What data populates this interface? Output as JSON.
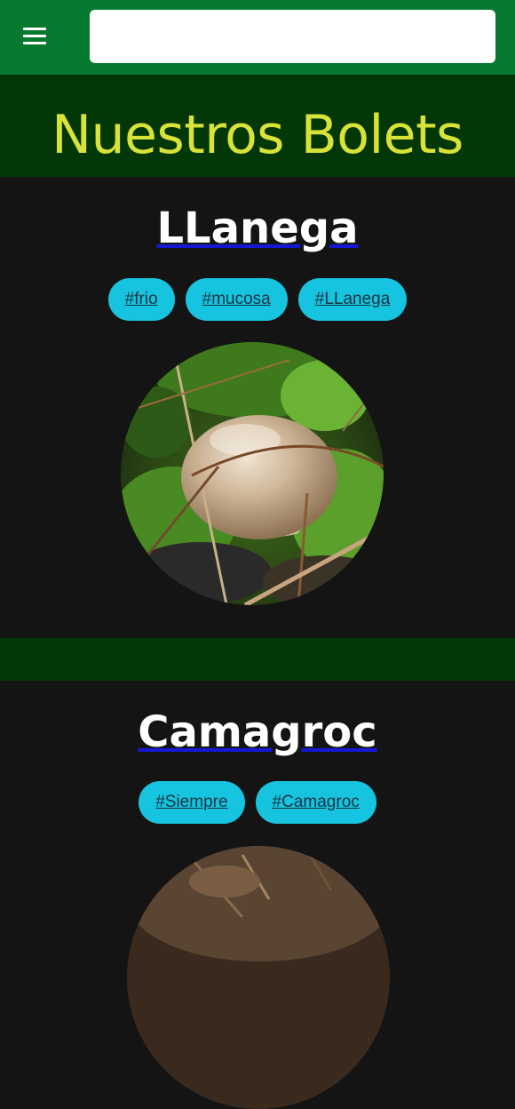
{
  "header": {
    "menu_icon": "hamburger-menu-icon",
    "search": {
      "value": "",
      "placeholder": ""
    },
    "colors": {
      "bar": "#077a32",
      "search_bg": "#ffffff"
    }
  },
  "hero": {
    "title": "Nuestros Bolets",
    "colors": {
      "bg": "#023808",
      "title": "#d9e237"
    }
  },
  "boletes": [
    {
      "name": "LLanega",
      "tags": [
        "#frio",
        "#mucosa",
        "#LLanega"
      ]
    },
    {
      "name": "Camagroc",
      "tags": [
        "#Siempre",
        "#Camagroc"
      ]
    }
  ],
  "colors": {
    "page_bg": "#141414",
    "tag_bg": "#16c4df",
    "tag_text": "#173444",
    "title_underline": "#1418d6"
  }
}
